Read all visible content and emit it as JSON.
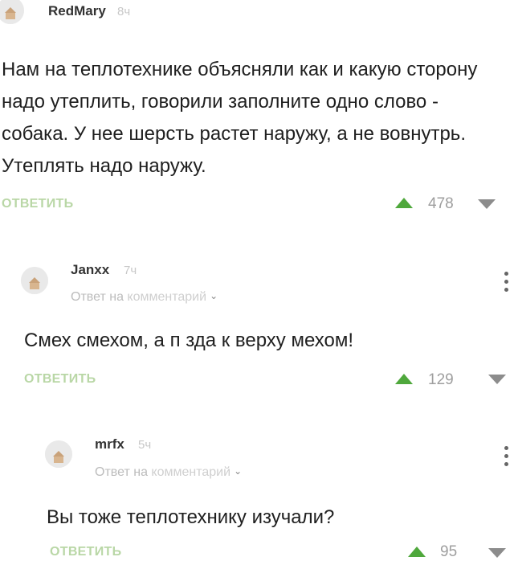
{
  "comments": [
    {
      "author": "RedMary",
      "time": "8ч",
      "text": "Нам на теплотехнике объясняли как и какую сторону надо утеплить, говорили заполните одно слово - собака. У нее шерсть растет наружу, а не вовнутрь. Утеплять надо наружу.",
      "reply_label": "ОТВЕТИТЬ",
      "votes": "478"
    },
    {
      "author": "Janxx",
      "time": "7ч",
      "reply_prefix": "Ответ на",
      "reply_target": "комментарий",
      "text": "Смех смехом, а п  зда к верху мехом!",
      "reply_label": "ОТВЕТИТЬ",
      "votes": "129"
    },
    {
      "author": "mrfx",
      "time": "5ч",
      "reply_prefix": "Ответ на",
      "reply_target": "комментарий",
      "text": "Вы тоже теплотехнику изучали?",
      "reply_label": "ОТВЕТИТЬ",
      "votes": "95"
    }
  ],
  "colors": {
    "reply_button": "#b9d7a6",
    "upvote": "#4fa83c",
    "downvote": "#8c8c8c",
    "muted": "#bcbcbc"
  },
  "icons": {
    "avatar": "default-house-avatar-icon",
    "upvote": "triangle-up-icon",
    "downvote": "triangle-down-icon",
    "more": "vertical-dots-menu-icon",
    "chevron": "chevron-down-icon"
  }
}
